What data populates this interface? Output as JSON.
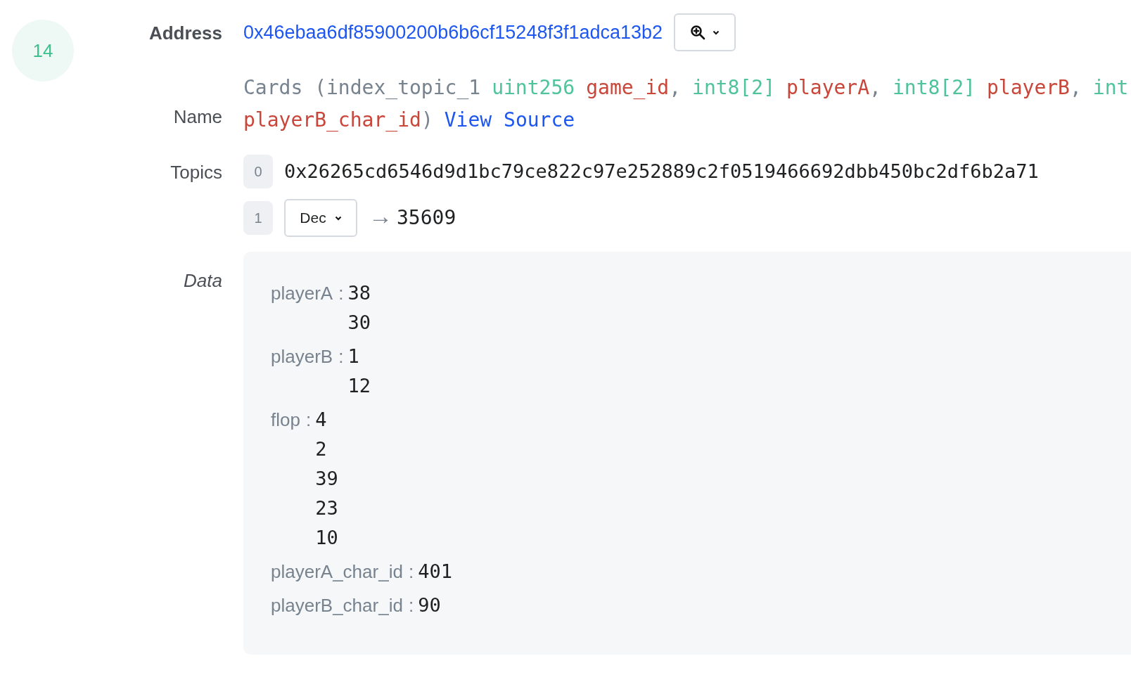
{
  "log_index": "14",
  "address": {
    "label": "Address",
    "value": "0x46ebaa6df85900200b6b6cf15248f3f1adca13b2"
  },
  "name": {
    "label": "Name",
    "lines": [
      [
        {
          "kind": "plain",
          "text": "Cards (index_topic_1"
        },
        {
          "kind": "type",
          "text": "uint256"
        },
        {
          "kind": "param",
          "text": "game_id"
        },
        {
          "kind": "plain",
          "text": ","
        },
        {
          "kind": "type",
          "text": "int8[2]"
        },
        {
          "kind": "param",
          "text": "playerA"
        },
        {
          "kind": "plain",
          "text": ","
        },
        {
          "kind": "type",
          "text": "int8[2]"
        },
        {
          "kind": "param",
          "text": "playerB"
        },
        {
          "kind": "plain",
          "text": ","
        },
        {
          "kind": "type",
          "text": "int"
        }
      ],
      [
        {
          "kind": "param",
          "text": "playerB_char_id"
        },
        {
          "kind": "plain",
          "text": ")"
        },
        {
          "kind": "link",
          "text": "View Source"
        }
      ]
    ]
  },
  "topics": {
    "label": "Topics",
    "items": [
      {
        "kind": "hash",
        "index": "0",
        "value": "0x26265cd6546d9d1bc79ce822c97e252889c2f0519466692dbb450bc2df6b2a71"
      },
      {
        "kind": "decoded",
        "index": "1",
        "format": "Dec",
        "arrow": "→",
        "value": "35609"
      }
    ]
  },
  "data": {
    "label": "Data",
    "fields": [
      {
        "name": "playerA",
        "separator": ":",
        "values": [
          "38",
          "30"
        ]
      },
      {
        "name": "playerB",
        "separator": ":",
        "values": [
          "1",
          "12"
        ]
      },
      {
        "name": "flop",
        "separator": ":",
        "values": [
          "4",
          "2",
          "39",
          "23",
          "10"
        ]
      },
      {
        "name": "playerA_char_id",
        "separator": ":",
        "values": [
          "401"
        ]
      },
      {
        "name": "playerB_char_id",
        "separator": ":",
        "values": [
          "90"
        ]
      }
    ]
  }
}
